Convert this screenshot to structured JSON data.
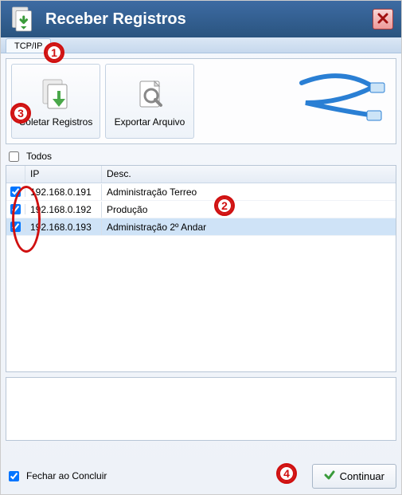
{
  "title": "Receber Registros",
  "tab": "TCP/IP",
  "toolbar": {
    "coletar": "Coletar Registros",
    "exportar": "Exportar Arquivo"
  },
  "todos_label": "Todos",
  "todos_checked": false,
  "columns": {
    "ip": "IP",
    "desc": "Desc."
  },
  "rows": [
    {
      "checked": true,
      "ip": "192.168.0.191",
      "desc": "Administração Terreo",
      "selected": false
    },
    {
      "checked": true,
      "ip": "192.168.0.192",
      "desc": "Produção",
      "selected": false
    },
    {
      "checked": true,
      "ip": "192.168.0.193",
      "desc": "Administração 2º Andar",
      "selected": true
    }
  ],
  "footer": {
    "fechar": "Fechar ao Concluir",
    "fechar_checked": true,
    "continuar": "Continuar"
  },
  "annotations": {
    "n1": "1",
    "n2": "2",
    "n3": "3",
    "n4": "4"
  }
}
